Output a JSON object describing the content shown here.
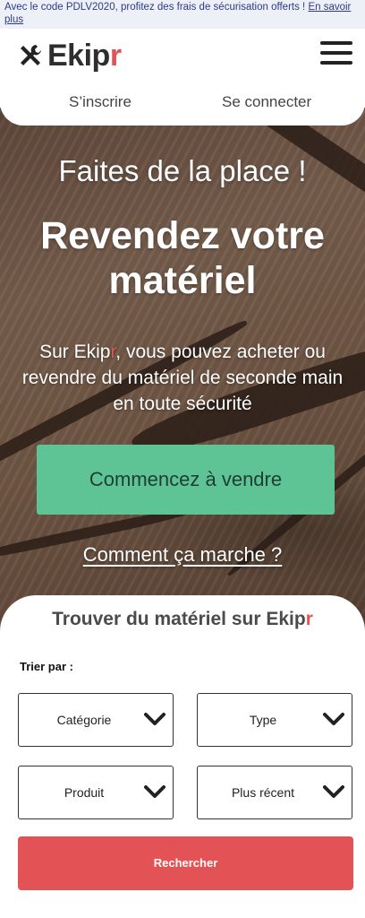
{
  "promo": {
    "text": "Avec le code PDLV2020, profitez des frais de sécurisation offerts ! ",
    "link": "En savoir plus"
  },
  "header": {
    "brand_main": "Ekip",
    "brand_accent": "r",
    "nav": {
      "signup": "S’inscrire",
      "login": "Se connecter"
    },
    "menu_icon": "hamburger-menu-icon",
    "logo_icon": "tools-icon"
  },
  "hero": {
    "subtitle": "Faites de la place !",
    "title": "Revendez votre matériel",
    "desc_before": "Sur Ekip",
    "desc_accent": "r",
    "desc_after": ", vous pouvez acheter ou revendre du matériel de seconde main en toute sécurité",
    "cta": "Commencez à vendre",
    "how_link": "Comment ça marche ?"
  },
  "finder": {
    "title_main": "Trouver du matériel sur Ekip",
    "title_accent": "r",
    "sort_label": "Trier par :",
    "selects": [
      {
        "value": "Catégorie"
      },
      {
        "value": "Type"
      },
      {
        "value": "Produit"
      },
      {
        "value": "Plus récent"
      }
    ],
    "search_button": "Rechercher"
  },
  "colors": {
    "accent_red": "#e05356",
    "cta_green": "#5ec496",
    "search_red": "#e35255",
    "promo_bg": "#eef0f8",
    "promo_text": "#2d3a86"
  }
}
